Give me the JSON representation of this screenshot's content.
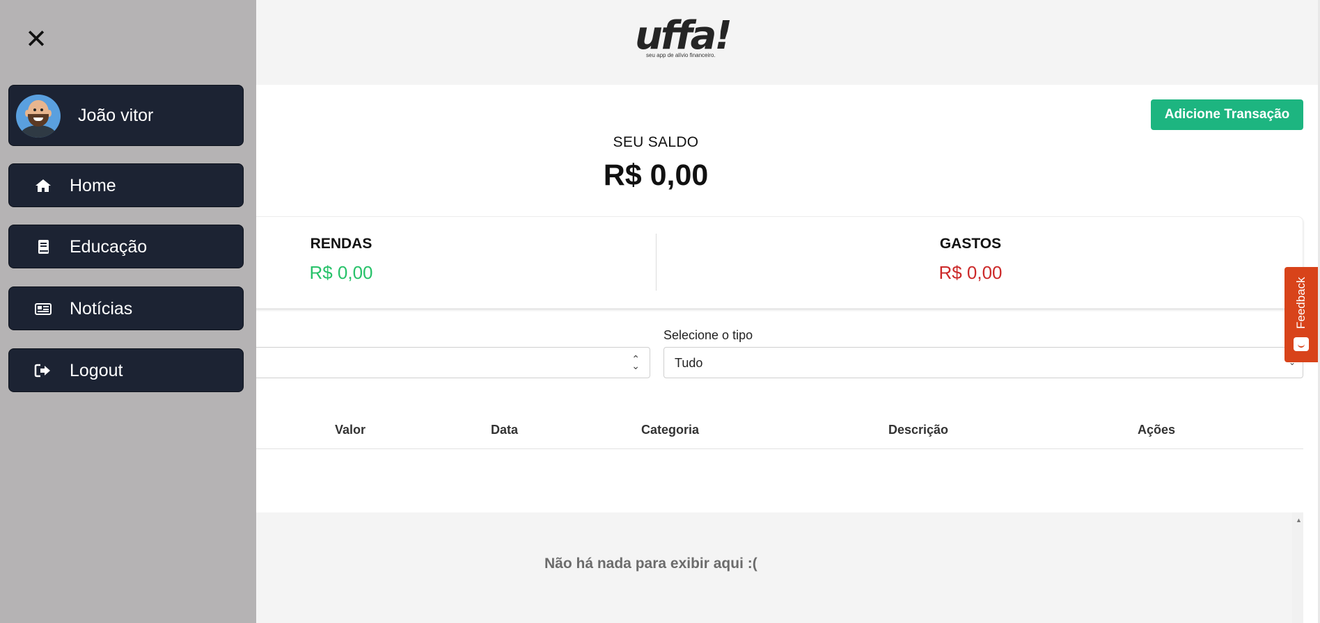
{
  "logo": {
    "word": "uffa!",
    "tagline": "seu app de alívio financeiro."
  },
  "sidebar": {
    "user_name": "João vitor",
    "items": [
      {
        "label": "Home",
        "icon": "home-icon"
      },
      {
        "label": "Educação",
        "icon": "book-icon"
      },
      {
        "label": "Notícias",
        "icon": "newspaper-icon"
      },
      {
        "label": "Logout",
        "icon": "logout-icon"
      }
    ]
  },
  "main": {
    "add_button": "Adicione Transação",
    "balance": {
      "label": "SEU SALDO",
      "value": "R$ 0,00"
    },
    "incomes": {
      "label": "RENDAS",
      "value": "R$ 0,00"
    },
    "expenses": {
      "label": "GASTOS",
      "value": "R$ 0,00"
    },
    "filters": {
      "type_label": "Selecione o tipo",
      "type_value": "Tudo",
      "first_select_value": ""
    },
    "table": {
      "columns": [
        "Valor",
        "Data",
        "Categoria",
        "Descrição",
        "Ações"
      ]
    },
    "empty_message": "Não há nada para exibir aqui :("
  },
  "feedback_tab": "Feedback",
  "colors": {
    "accent": "#1db580",
    "income": "#28c26a",
    "expense": "#cc2a2a",
    "sidebar_item": "#1c2333",
    "feedback": "#d8431a"
  }
}
